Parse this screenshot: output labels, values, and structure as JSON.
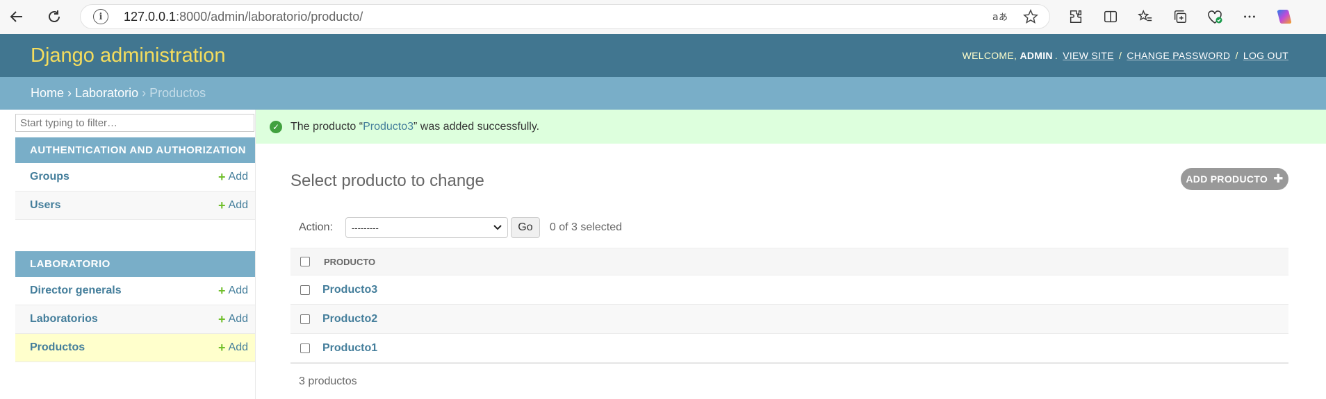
{
  "browser": {
    "url_host": "127.0.0.1",
    "url_rest": ":8000/admin/laboratorio/producto/"
  },
  "header": {
    "branding": "Django administration",
    "welcome": "WELCOME,",
    "user": "ADMIN",
    "view_site": "VIEW SITE",
    "change_password": "CHANGE PASSWORD",
    "log_out": "LOG OUT"
  },
  "breadcrumbs": {
    "home": "Home",
    "app": "Laboratorio",
    "current": "Productos"
  },
  "sidebar": {
    "filter_placeholder": "Start typing to filter…",
    "modules": [
      {
        "caption": "AUTHENTICATION AND AUTHORIZATION",
        "items": [
          {
            "name": "Groups",
            "add": "Add"
          },
          {
            "name": "Users",
            "add": "Add"
          }
        ]
      },
      {
        "caption": "LABORATORIO",
        "items": [
          {
            "name": "Director generals",
            "add": "Add"
          },
          {
            "name": "Laboratorios",
            "add": "Add"
          },
          {
            "name": "Productos",
            "add": "Add"
          }
        ]
      }
    ]
  },
  "message": {
    "prefix": "The producto “",
    "link": "Producto3",
    "suffix": "” was added successfully."
  },
  "content": {
    "title": "Select producto to change",
    "add_button": "ADD PRODUCTO",
    "action_label": "Action:",
    "action_selected": "---------",
    "go": "Go",
    "counter": "0 of 3 selected",
    "column_header": "PRODUCTO",
    "rows": [
      "Producto3",
      "Producto2",
      "Producto1"
    ],
    "paginator": "3 productos"
  }
}
